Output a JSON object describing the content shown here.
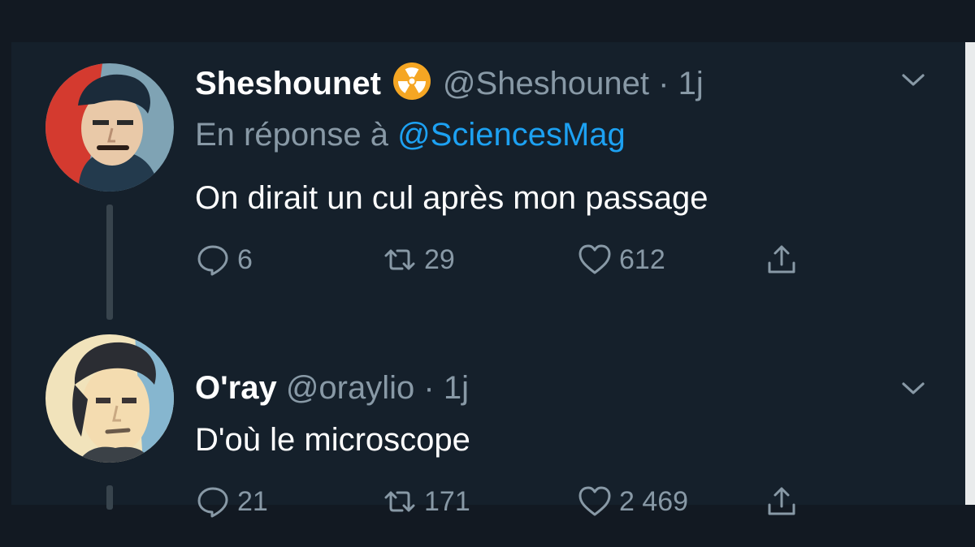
{
  "tweets": [
    {
      "name": "Sheshounet",
      "badge_icon": "radioactive-icon",
      "badge_color": "#f5a623",
      "handle": "@Sheshounet",
      "separator": "·",
      "time": "1j",
      "reply_to_lead": "En réponse à",
      "reply_to_mention": "@SciencesMag",
      "text": "On dirait un cul après mon passage",
      "replies": "6",
      "retweets": "29",
      "likes": "612"
    },
    {
      "name": "O'ray",
      "handle": "@oraylio",
      "separator": "·",
      "time": "1j",
      "text": "D'où le microscope",
      "replies": "21",
      "retweets": "171",
      "likes": "2 469"
    }
  ],
  "colors": {
    "background": "#15202b",
    "secondary_text": "#8899a6",
    "link": "#1da1f2",
    "thread_line": "#38444d"
  }
}
